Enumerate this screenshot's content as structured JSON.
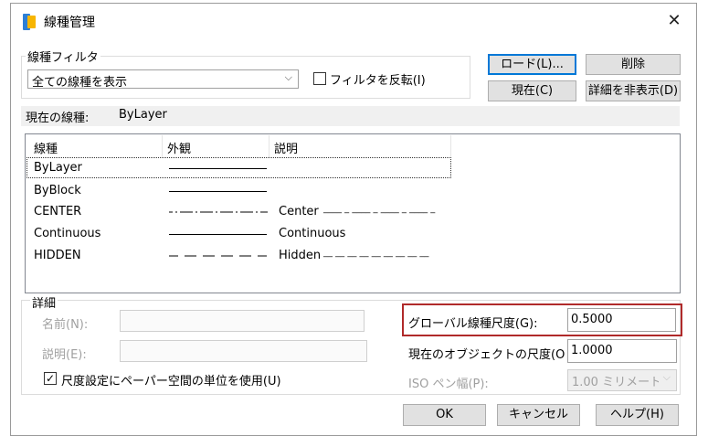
{
  "window": {
    "title": "線種管理",
    "close_glyph": "✕"
  },
  "filter": {
    "group_label": "線種フィルタ",
    "selected": "全ての線種を表示",
    "invert_label": "フィルタを反転(I)",
    "invert_checked": false
  },
  "buttons": {
    "load": "ロード(L)...",
    "delete": "削除",
    "current": "現在(C)",
    "hide_details": "詳細を非表示(D)",
    "ok": "OK",
    "cancel": "キャンセル",
    "help": "ヘルプ(H)"
  },
  "current_linetype": {
    "label": "現在の線種:",
    "value": "ByLayer"
  },
  "linetype_table": {
    "headers": [
      "線種",
      "外観",
      "説明"
    ],
    "rows": [
      {
        "name": "ByLayer",
        "appearance": "solid",
        "description": ""
      },
      {
        "name": "ByBlock",
        "appearance": "solid",
        "description": ""
      },
      {
        "name": "CENTER",
        "appearance": "center",
        "description": "Center",
        "pattern": "____ _ ____ _ ____ _ ____ _"
      },
      {
        "name": "Continuous",
        "appearance": "solid",
        "description": "Continuous"
      },
      {
        "name": "HIDDEN",
        "appearance": "hidden",
        "description": "Hidden",
        "pattern": "__ __ __ __ __ __ __ __ __"
      }
    ],
    "selected_row": 0
  },
  "details": {
    "group_label": "詳細",
    "name_label": "名前(N):",
    "description_label": "説明(E):",
    "paper_space_label": "尺度設定にペーパー空間の単位を使用(U)",
    "paper_space_checked": true,
    "global_scale_label": "グローバル線種尺度(G):",
    "global_scale_value": "0.5000",
    "object_scale_label": "現在のオブジェクトの尺度(O",
    "object_scale_value": "1.0000",
    "iso_pen_label": "ISO ペン幅(P):",
    "iso_pen_value": "1.00 ミリメートル"
  },
  "colors": {
    "accent": "#0078d7",
    "highlight": "#b02a2a",
    "disabled": "#a0a0a0"
  }
}
